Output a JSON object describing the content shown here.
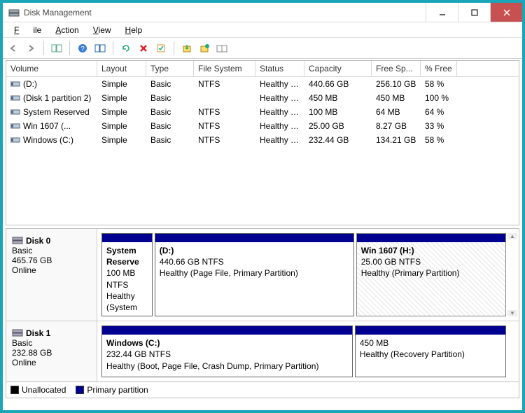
{
  "window": {
    "title": "Disk Management"
  },
  "menu": {
    "file": "File",
    "action": "Action",
    "view": "View",
    "help": "Help"
  },
  "columns": {
    "volume": "Volume",
    "layout": "Layout",
    "type": "Type",
    "filesystem": "File System",
    "status": "Status",
    "capacity": "Capacity",
    "freespace": "Free Sp...",
    "pctfree": "% Free"
  },
  "volumes": [
    {
      "name": "(D:)",
      "layout": "Simple",
      "type": "Basic",
      "fs": "NTFS",
      "status": "Healthy (P...",
      "capacity": "440.66 GB",
      "free": "256.10 GB",
      "pct": "58 %"
    },
    {
      "name": "(Disk 1 partition 2)",
      "layout": "Simple",
      "type": "Basic",
      "fs": "",
      "status": "Healthy (R...",
      "capacity": "450 MB",
      "free": "450 MB",
      "pct": "100 %"
    },
    {
      "name": "System Reserved",
      "layout": "Simple",
      "type": "Basic",
      "fs": "NTFS",
      "status": "Healthy (S...",
      "capacity": "100 MB",
      "free": "64 MB",
      "pct": "64 %"
    },
    {
      "name": "Win 1607 (...",
      "layout": "Simple",
      "type": "Basic",
      "fs": "NTFS",
      "status": "Healthy (P...",
      "capacity": "25.00 GB",
      "free": "8.27 GB",
      "pct": "33 %"
    },
    {
      "name": "Windows (C:)",
      "layout": "Simple",
      "type": "Basic",
      "fs": "NTFS",
      "status": "Healthy (B...",
      "capacity": "232.44 GB",
      "free": "134.21 GB",
      "pct": "58 %"
    }
  ],
  "disks": [
    {
      "name": "Disk 0",
      "type": "Basic",
      "size": "465.76 GB",
      "state": "Online",
      "partitions": [
        {
          "title": "System Reserve",
          "sub1": "100 MB NTFS",
          "sub2": "Healthy (System",
          "flex": 1
        },
        {
          "title": "(D:)",
          "sub1": "440.66 GB NTFS",
          "sub2": "Healthy (Page File, Primary Partition)",
          "flex": 4
        },
        {
          "title": "Win 1607  (H:)",
          "sub1": "25.00 GB NTFS",
          "sub2": "Healthy (Primary Partition)",
          "flex": 3,
          "selected": true
        }
      ]
    },
    {
      "name": "Disk 1",
      "type": "Basic",
      "size": "232.88 GB",
      "state": "Online",
      "partitions": [
        {
          "title": "Windows  (C:)",
          "sub1": "232.44 GB NTFS",
          "sub2": "Healthy (Boot, Page File, Crash Dump, Primary Partition)",
          "flex": 5
        },
        {
          "title": "",
          "sub1": "450 MB",
          "sub2": "Healthy (Recovery Partition)",
          "flex": 3
        }
      ]
    }
  ],
  "legend": {
    "unallocated": "Unallocated",
    "primary": "Primary partition"
  }
}
